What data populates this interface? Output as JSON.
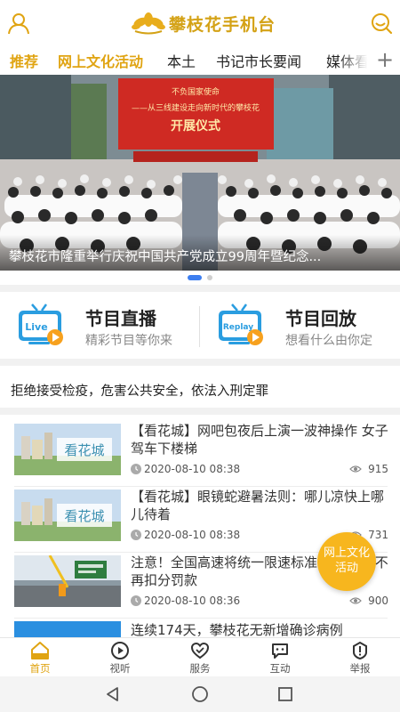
{
  "app": {
    "title": "攀枝花手机台",
    "brand_color": "#d4a216",
    "accent_color": "#e0a412"
  },
  "tabs": [
    {
      "label": "推荐",
      "active": true
    },
    {
      "label": "网上文化活动"
    },
    {
      "label": "本土"
    },
    {
      "label": "书记市长要闻"
    },
    {
      "label": "媒体看"
    }
  ],
  "tabs_more_icon": "plus-icon",
  "banner": {
    "sign_title": "不负国家使命",
    "sign_subtitle": "——从三线建设走向新时代的攀枝花",
    "sign_ceremony": "开展仪式",
    "caption": "攀枝花市隆重举行庆祝中国共产党成立99周年暨纪念...",
    "slide_count": 2,
    "active_slide": 1
  },
  "programs": [
    {
      "badge": "Live",
      "title": "节目直播",
      "subtitle": "精彩节目等你来",
      "icon": "tv-live-icon"
    },
    {
      "badge": "Replay",
      "title": "节目回放",
      "subtitle": "想看什么由你定",
      "icon": "tv-replay-icon"
    }
  ],
  "notice": "拒绝接受检疫，危害公共安全，依法入刑定罪",
  "news": [
    {
      "title": "【看花城】网吧包夜后上演一波神操作 女子驾车下楼梯",
      "date": "2020-08-10 08:38",
      "views": "915",
      "thumb_text": "看花城"
    },
    {
      "title": "【看花城】眼镜蛇避暑法则：哪儿凉快上哪儿待着",
      "date": "2020-08-10 08:38",
      "views": "731",
      "thumb_text": "看花城"
    },
    {
      "title": "注意！全国高速将统一限速标准 这些情况不再扣分罚款",
      "date": "2020-08-10 08:36",
      "views": "900",
      "thumb_text": ""
    },
    {
      "title": "连续174天，攀枝花无新增确诊病例",
      "date": "",
      "views": "",
      "thumb_text": ""
    }
  ],
  "floating_button": {
    "line1": "网上文化",
    "line2": "活动",
    "color": "#f7b61e"
  },
  "bottom_nav": [
    {
      "label": "首页",
      "icon": "home-icon",
      "active": true
    },
    {
      "label": "视听",
      "icon": "play-icon"
    },
    {
      "label": "服务",
      "icon": "heart-icon"
    },
    {
      "label": "互动",
      "icon": "chat-icon"
    },
    {
      "label": "举报",
      "icon": "alert-icon"
    }
  ],
  "system_nav": [
    "back-icon",
    "home-circle-icon",
    "recents-icon"
  ]
}
